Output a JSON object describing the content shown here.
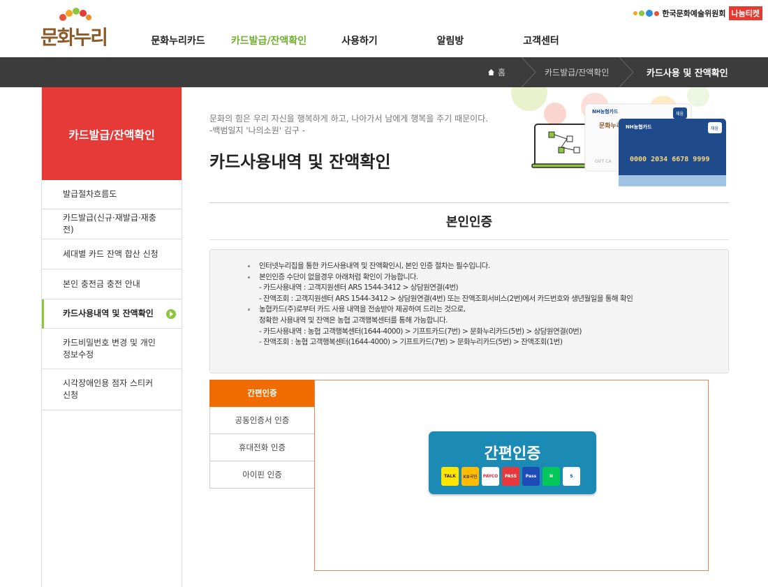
{
  "brand": {
    "logo_text": "문화누리"
  },
  "partner": {
    "org": "한국문화예술위원회",
    "ticket": "나눔티켓"
  },
  "gnb": [
    {
      "label": "문화누리카드",
      "active": false
    },
    {
      "label": "카드발급/잔액확인",
      "active": true
    },
    {
      "label": "사용하기",
      "active": false
    },
    {
      "label": "알림방",
      "active": false
    },
    {
      "label": "고객센터",
      "active": false
    }
  ],
  "breadcrumb": {
    "home": "홈",
    "parent": "카드발급/잔액확인",
    "current": "카드사용 및 잔액확인"
  },
  "lnb": {
    "title": "카드발급/잔액확인",
    "items": [
      {
        "label": "발급절차흐름도"
      },
      {
        "label": "카드발급(신규·재발급·재충전)"
      },
      {
        "label": "세대별 카드 잔액 합산 신청"
      },
      {
        "label": "본인 충전금 충전 안내"
      },
      {
        "label": "카드사용내역 및 잔액확인"
      },
      {
        "label": "카드비밀번호 변경 및 개인 정보수정"
      },
      {
        "label": "시각장애인용 점자 스티커 신청"
      }
    ]
  },
  "page": {
    "quote1": "문화의 힘은 우리 자신을 행복하게 하고, 나아가서 남에게 행복을 주기 때문이다.",
    "quote2": "-백범일지 '나의소원' 김구 -",
    "title": "카드사용내역 및 잔액확인",
    "section": "본인인증"
  },
  "visual": {
    "card_brand": "NH농협카드",
    "card_number": "0000 2034 6678 9999",
    "card_tag": "채움",
    "back_card_text": "GIFT CA"
  },
  "notice": [
    "인터넷누리집을 통한 카드사용내역 및 잔액확인시, 본인 인증 절차는 필수입니다.",
    "본인인증 수단이 없을경우 아래처럼 확인이 가능합니다.",
    "- 카드사용내역 : 고객지원센터 ARS 1544-3412 > 상담원연결(4번)",
    "- 잔액조회 : 고객지원센터 ARS 1544-3412 > 상담원연결(4번) 또는 잔액조회서비스(2번)에서 카드번호와 생년월일을 통해 확인",
    "농협카드(주)로부터 카드 사용 내역을 전송받아 제공하여 드리는 것으로,",
    "정확한 사용내역 및 잔액은 농협 고객행복센터를 통해 가능합니다.",
    "- 카드사용내역 : 농협 고객행복센터(1644-4000) > 기프트카드(7번) > 문화누리카드(5번) > 상담원연결(0번)",
    "- 잔액조회 : 농협 고객행복센터(1644-4000) > 기프트카드(7번) > 문화누리카드(5번) > 잔액조회(1번)"
  ],
  "tabs": [
    {
      "label": "간편인증",
      "active": true
    },
    {
      "label": "공동인증서 인증",
      "active": false
    },
    {
      "label": "휴대전화 인증",
      "active": false
    },
    {
      "label": "아이핀 인증",
      "active": false
    }
  ],
  "easy_auth": {
    "label": "간편인증",
    "providers": [
      {
        "name": "kakao-icon",
        "text": "TALK",
        "bg": "#fee500",
        "fg": "#3a1d1d"
      },
      {
        "name": "kb-icon",
        "text": "KB국민",
        "bg": "#ffbc00",
        "fg": "#5a4a3a"
      },
      {
        "name": "payco-icon",
        "text": "PAYCO",
        "bg": "#ffffff",
        "fg": "#e5283c"
      },
      {
        "name": "pass-icon",
        "text": "PASS",
        "bg": "#e8383d",
        "fg": "#ffffff"
      },
      {
        "name": "samsung-pass-icon",
        "text": "Pass",
        "bg": "#1e4bb8",
        "fg": "#ffffff"
      },
      {
        "name": "naver-icon",
        "text": "N",
        "bg": "#03c75a",
        "fg": "#ffffff"
      },
      {
        "name": "shinhan-icon",
        "text": "S",
        "bg": "#ffffff",
        "fg": "#0046ff"
      }
    ]
  }
}
